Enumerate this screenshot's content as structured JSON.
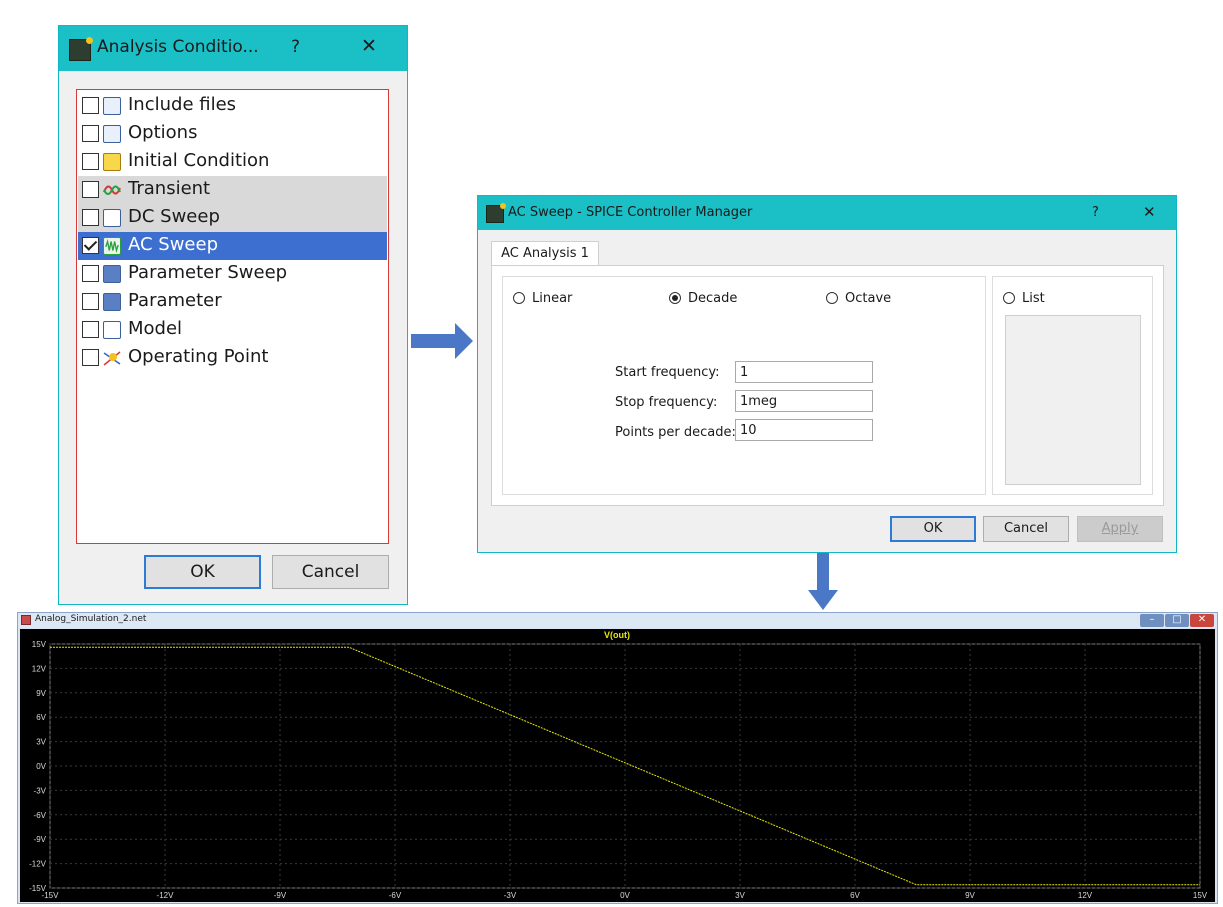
{
  "analysis_dialog": {
    "title": "Analysis Conditio...",
    "help": "?",
    "close": "✕",
    "items": [
      {
        "label": "Include files",
        "checked": false,
        "state": "normal"
      },
      {
        "label": "Options",
        "checked": false,
        "state": "normal"
      },
      {
        "label": "Initial Condition",
        "checked": false,
        "state": "normal"
      },
      {
        "label": "Transient",
        "checked": false,
        "state": "gray"
      },
      {
        "label": "DC Sweep",
        "checked": false,
        "state": "gray"
      },
      {
        "label": "AC Sweep",
        "checked": true,
        "state": "selected"
      },
      {
        "label": "Parameter Sweep",
        "checked": false,
        "state": "normal"
      },
      {
        "label": "Parameter",
        "checked": false,
        "state": "normal"
      },
      {
        "label": "Model",
        "checked": false,
        "state": "normal"
      },
      {
        "label": "Operating Point",
        "checked": false,
        "state": "normal"
      }
    ],
    "ok": "OK",
    "cancel": "Cancel"
  },
  "ac_dialog": {
    "title": "AC Sweep - SPICE Controller Manager",
    "help": "?",
    "close": "✕",
    "tab": "AC Analysis 1",
    "radios": {
      "linear": "Linear",
      "decade": "Decade",
      "octave": "Octave",
      "list": "List"
    },
    "selected_radio": "Decade",
    "fields": {
      "start_label": "Start frequency:",
      "start_value": "1",
      "stop_label": "Stop frequency:",
      "stop_value": "1meg",
      "points_label": "Points per decade:",
      "points_value": "10"
    },
    "ok": "OK",
    "cancel": "Cancel",
    "apply": "Apply"
  },
  "plot_window": {
    "title": "Analog_Simulation_2.net",
    "win_min": "–",
    "win_max": "□",
    "win_close": "✕"
  },
  "chart_data": {
    "type": "line",
    "title": "V(out)",
    "xlabel": "",
    "ylabel": "",
    "xlim": [
      -15,
      15
    ],
    "ylim": [
      -15,
      15
    ],
    "xticks": [
      "-15V",
      "-12V",
      "-9V",
      "-6V",
      "-3V",
      "0V",
      "3V",
      "6V",
      "9V",
      "12V",
      "15V"
    ],
    "yticks": [
      "15V",
      "12V",
      "9V",
      "6V",
      "3V",
      "0V",
      "-3V",
      "-6V",
      "-9V",
      "-12V",
      "-15V"
    ],
    "grid": true,
    "series": [
      {
        "name": "V(out)",
        "color": "#e8e800",
        "x": [
          -15,
          -7.2,
          7.6,
          15
        ],
        "y": [
          14.6,
          14.6,
          -14.6,
          -14.6
        ]
      }
    ]
  },
  "colors": {
    "titlebar": "#1bbfc6",
    "selection": "#3d6fd0",
    "arrow": "#4a78c6",
    "trace": "#e8e800"
  }
}
